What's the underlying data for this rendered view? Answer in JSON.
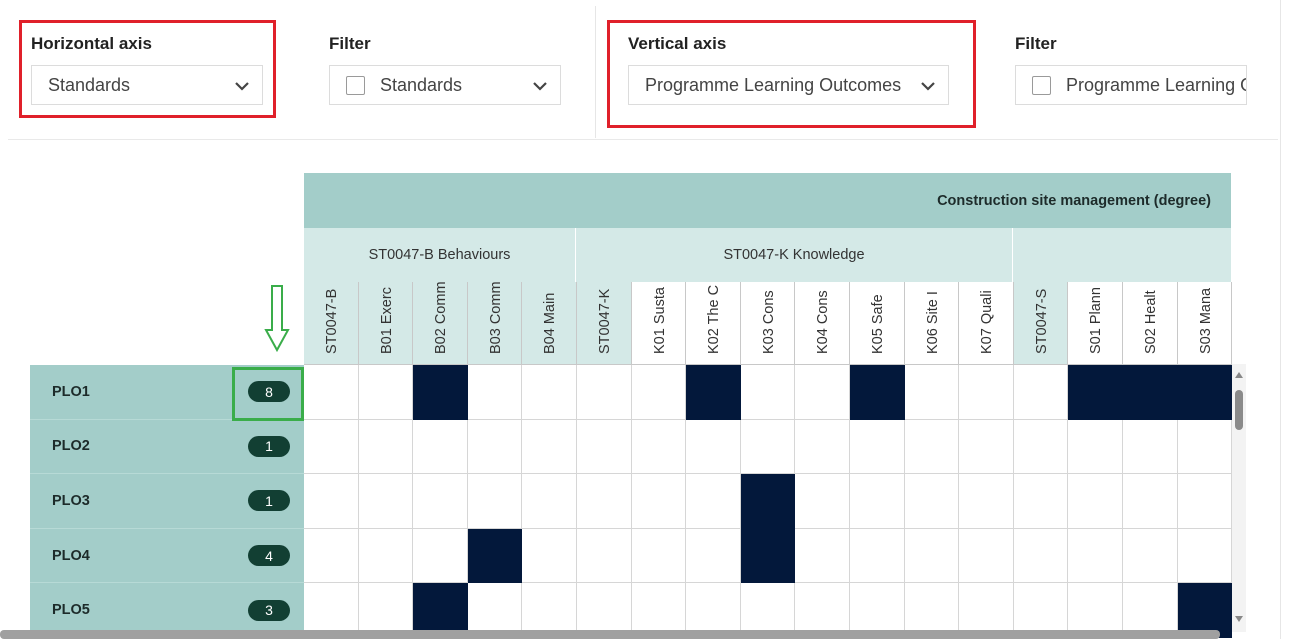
{
  "filters": {
    "horizontal_axis": {
      "label": "Horizontal axis",
      "value": "Standards"
    },
    "filter_1": {
      "label": "Filter",
      "value": "Standards"
    },
    "vertical_axis": {
      "label": "Vertical axis",
      "value": "Programme Learning Outcomes"
    },
    "filter_2": {
      "label": "Filter",
      "value": "Programme Learning Outco"
    }
  },
  "matrix": {
    "group_title": "Construction site management (degree)",
    "subgroups": [
      {
        "label": "ST0047-B Behaviours"
      },
      {
        "label": "ST0047-K Knowledge"
      },
      {
        "label": ""
      }
    ],
    "columns": [
      {
        "label": "ST0047-B",
        "tint": true
      },
      {
        "label": "B01 Exerc",
        "tint": true
      },
      {
        "label": "B02 Comm",
        "tint": true
      },
      {
        "label": "B03 Comm",
        "tint": true
      },
      {
        "label": "B04 Main",
        "tint": true
      },
      {
        "label": "ST0047-K",
        "tint": true
      },
      {
        "label": "K01 Susta",
        "tint": false
      },
      {
        "label": "K02 The C",
        "tint": false
      },
      {
        "label": "K03 Cons",
        "tint": false
      },
      {
        "label": "K04 Cons",
        "tint": false
      },
      {
        "label": "K05 Safe",
        "tint": false
      },
      {
        "label": "K06 Site I",
        "tint": false
      },
      {
        "label": "K07 Quali",
        "tint": false
      },
      {
        "label": "ST0047-S",
        "tint": true
      },
      {
        "label": "S01 Plann",
        "tint": false
      },
      {
        "label": "S02 Healt",
        "tint": false
      },
      {
        "label": "S03 Mana",
        "tint": false
      }
    ],
    "rows": [
      {
        "label": "PLO1",
        "count": "8",
        "cells": [
          0,
          0,
          1,
          0,
          0,
          0,
          0,
          1,
          0,
          0,
          1,
          0,
          0,
          0,
          1,
          1,
          1
        ]
      },
      {
        "label": "PLO2",
        "count": "1",
        "cells": [
          0,
          0,
          0,
          0,
          0,
          0,
          0,
          0,
          0,
          0,
          0,
          0,
          0,
          0,
          0,
          0,
          0
        ]
      },
      {
        "label": "PLO3",
        "count": "1",
        "cells": [
          0,
          0,
          0,
          0,
          0,
          0,
          0,
          0,
          1,
          0,
          0,
          0,
          0,
          0,
          0,
          0,
          0
        ]
      },
      {
        "label": "PLO4",
        "count": "4",
        "cells": [
          0,
          0,
          0,
          1,
          0,
          0,
          0,
          0,
          1,
          0,
          0,
          0,
          0,
          0,
          0,
          0,
          0
        ]
      },
      {
        "label": "PLO5",
        "count": "3",
        "cells": [
          0,
          0,
          1,
          0,
          0,
          0,
          0,
          0,
          0,
          0,
          0,
          0,
          0,
          0,
          0,
          0,
          1
        ]
      }
    ]
  },
  "colors": {
    "header_teal": "#a3cdc9",
    "subheader_teal": "#d4e9e7",
    "filled_cell": "#03183b",
    "badge": "#123f33",
    "highlight_red": "#e0202a",
    "highlight_green": "#3aad4a"
  }
}
